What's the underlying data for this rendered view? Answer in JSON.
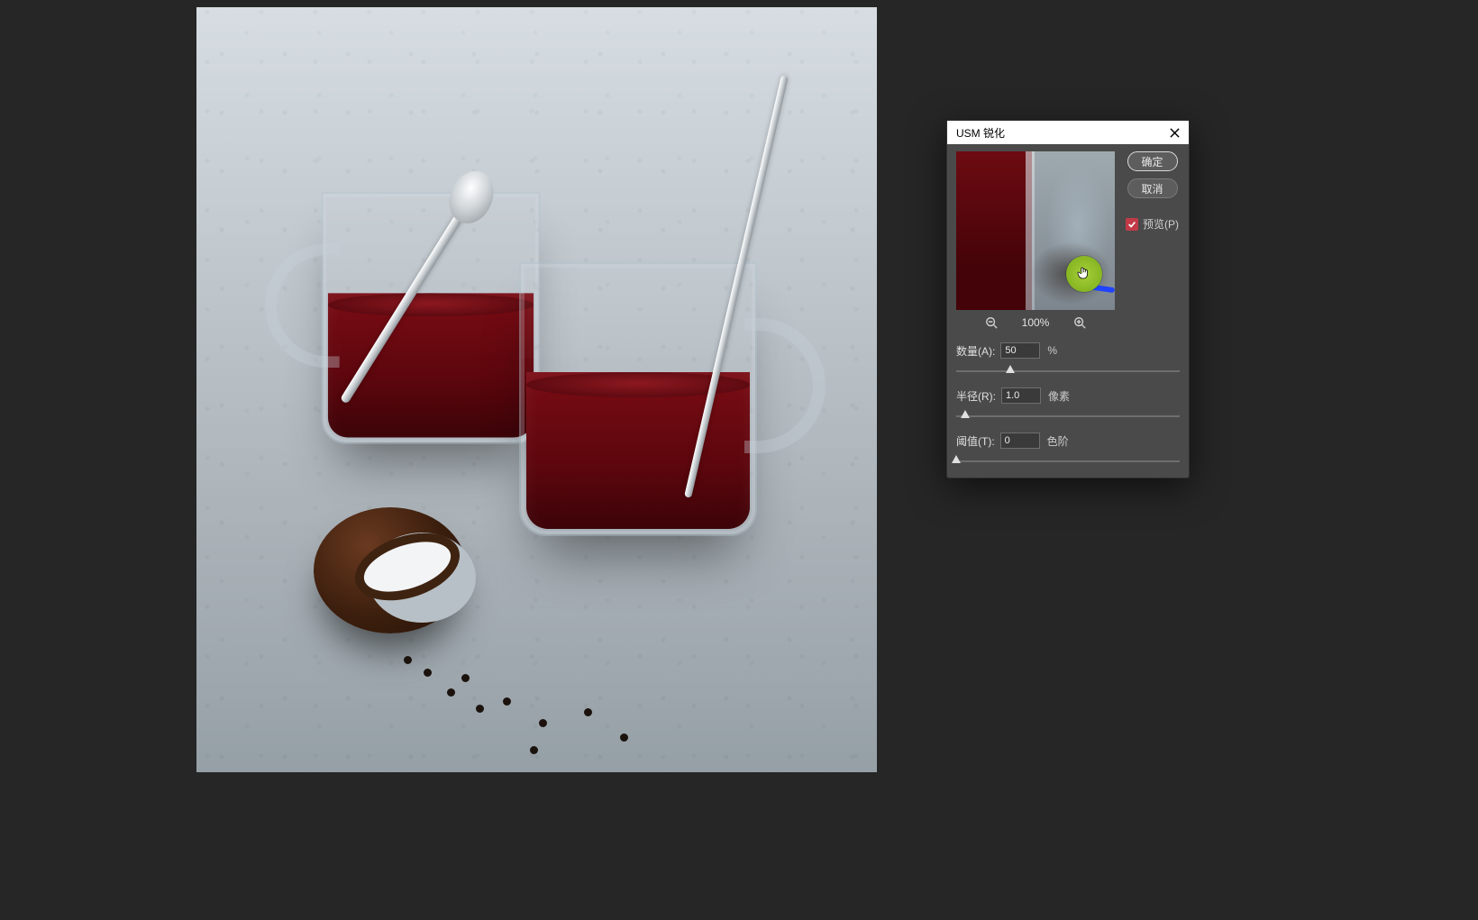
{
  "dialog": {
    "title": "USM 锐化",
    "buttons": {
      "ok": "确定",
      "cancel": "取消"
    },
    "preview_label": "预览(P)",
    "preview_checked": true,
    "zoom": {
      "value": "100%"
    },
    "params": {
      "amount": {
        "label": "数量(A):",
        "value": "50",
        "unit": "%",
        "thumb_pct": 24
      },
      "radius": {
        "label": "半径(R):",
        "value": "1.0",
        "unit": "像素",
        "thumb_pct": 4
      },
      "thresh": {
        "label": "阈值(T):",
        "value": "0",
        "unit": "色阶",
        "thumb_pct": 0
      }
    }
  }
}
